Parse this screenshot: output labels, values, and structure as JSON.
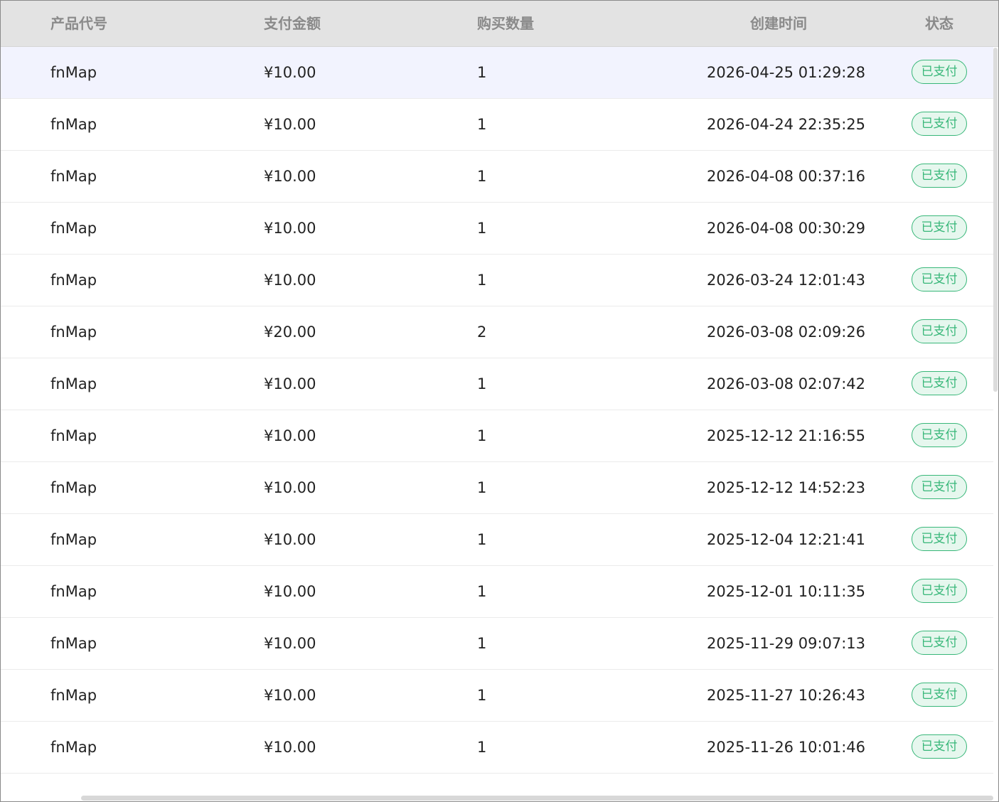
{
  "table": {
    "headers": {
      "product_code": "产品代号",
      "amount": "支付金额",
      "quantity": "购买数量",
      "created_at": "创建时间",
      "status": "状态"
    },
    "rows": [
      {
        "product_code": "fnMap",
        "amount": "¥10.00",
        "quantity": "1",
        "created_at": "2026-04-25 01:29:28",
        "status": "已支付"
      },
      {
        "product_code": "fnMap",
        "amount": "¥10.00",
        "quantity": "1",
        "created_at": "2026-04-24 22:35:25",
        "status": "已支付"
      },
      {
        "product_code": "fnMap",
        "amount": "¥10.00",
        "quantity": "1",
        "created_at": "2026-04-08 00:37:16",
        "status": "已支付"
      },
      {
        "product_code": "fnMap",
        "amount": "¥10.00",
        "quantity": "1",
        "created_at": "2026-04-08 00:30:29",
        "status": "已支付"
      },
      {
        "product_code": "fnMap",
        "amount": "¥10.00",
        "quantity": "1",
        "created_at": "2026-03-24 12:01:43",
        "status": "已支付"
      },
      {
        "product_code": "fnMap",
        "amount": "¥20.00",
        "quantity": "2",
        "created_at": "2026-03-08 02:09:26",
        "status": "已支付"
      },
      {
        "product_code": "fnMap",
        "amount": "¥10.00",
        "quantity": "1",
        "created_at": "2026-03-08 02:07:42",
        "status": "已支付"
      },
      {
        "product_code": "fnMap",
        "amount": "¥10.00",
        "quantity": "1",
        "created_at": "2025-12-12 21:16:55",
        "status": "已支付"
      },
      {
        "product_code": "fnMap",
        "amount": "¥10.00",
        "quantity": "1",
        "created_at": "2025-12-12 14:52:23",
        "status": "已支付"
      },
      {
        "product_code": "fnMap",
        "amount": "¥10.00",
        "quantity": "1",
        "created_at": "2025-12-04 12:21:41",
        "status": "已支付"
      },
      {
        "product_code": "fnMap",
        "amount": "¥10.00",
        "quantity": "1",
        "created_at": "2025-12-01 10:11:35",
        "status": "已支付"
      },
      {
        "product_code": "fnMap",
        "amount": "¥10.00",
        "quantity": "1",
        "created_at": "2025-11-29 09:07:13",
        "status": "已支付"
      },
      {
        "product_code": "fnMap",
        "amount": "¥10.00",
        "quantity": "1",
        "created_at": "2025-11-27 10:26:43",
        "status": "已支付"
      },
      {
        "product_code": "fnMap",
        "amount": "¥10.00",
        "quantity": "1",
        "created_at": "2025-11-26 10:01:46",
        "status": "已支付"
      }
    ]
  },
  "colors": {
    "header_bg": "#e3e3e3",
    "header_text": "#8a8a8a",
    "hover_row_bg": "#f2f3fe",
    "status_paid": "#38b779",
    "status_paid_bg": "#e6f7ee"
  }
}
